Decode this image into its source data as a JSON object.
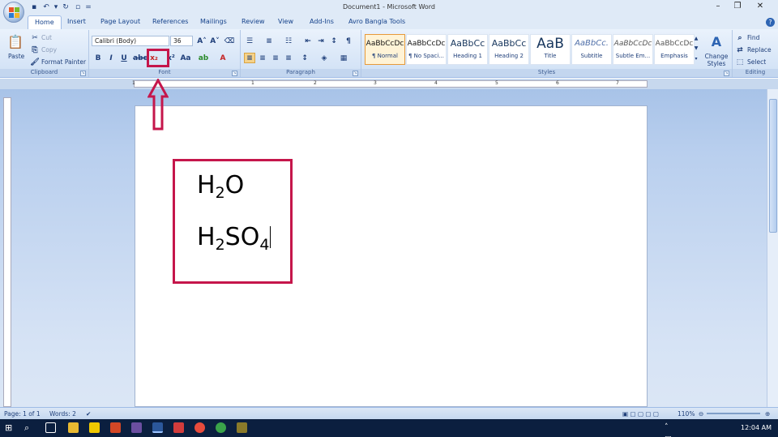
{
  "window": {
    "title": "Document1 - Microsoft Word"
  },
  "qat": {
    "more": "="
  },
  "tabs": [
    "Home",
    "Insert",
    "Page Layout",
    "References",
    "Mailings",
    "Review",
    "View",
    "Add-Ins",
    "Avro Bangla Tools"
  ],
  "clipboard": {
    "paste": "Paste",
    "cut": "Cut",
    "copy": "Copy",
    "format_painter": "Format Painter",
    "label": "Clipboard"
  },
  "font": {
    "name": "Calibri (Body)",
    "size": "36",
    "label": "Font"
  },
  "paragraph": {
    "label": "Paragraph"
  },
  "styles": {
    "tiles": [
      {
        "preview": "AaBbCcDc",
        "name": "¶ Normal",
        "selected": true
      },
      {
        "preview": "AaBbCcDc",
        "name": "¶ No Spaci...",
        "selected": false
      },
      {
        "preview": "AaBbCc",
        "name": "Heading 1",
        "selected": false
      },
      {
        "preview": "AaBbCc",
        "name": "Heading 2",
        "selected": false
      },
      {
        "preview": "AaB",
        "name": "Title",
        "selected": false
      },
      {
        "preview": "AaBbCc.",
        "name": "Subtitle",
        "selected": false
      },
      {
        "preview": "AaBbCcDc",
        "name": "Subtle Em...",
        "selected": false
      },
      {
        "preview": "AaBbCcDc",
        "name": "Emphasis",
        "selected": false
      }
    ],
    "change_styles": "Change Styles",
    "label": "Styles"
  },
  "editing": {
    "find": "Find",
    "replace": "Replace",
    "select": "Select",
    "label": "Editing"
  },
  "ruler_numbers": [
    "1",
    "1",
    "2",
    "3",
    "4",
    "5",
    "6",
    "7"
  ],
  "document": {
    "formula1": {
      "main": "H",
      "sub": "2",
      "tail": "O"
    },
    "formula2": {
      "main": "H",
      "sub1": "2",
      "mid": "SO",
      "sub2": "4"
    }
  },
  "status": {
    "page": "Page: 1 of 1",
    "words": "Words: 2",
    "zoom": "110%"
  },
  "taskbar": {
    "time": "12:04 AM"
  },
  "colors": {
    "accent": "#c5164b",
    "ribbon": "#dfeaf7"
  }
}
